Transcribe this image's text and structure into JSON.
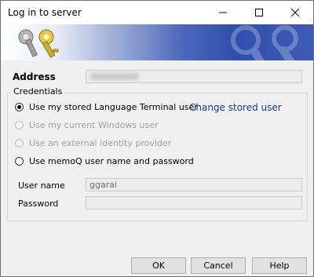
{
  "window": {
    "title": "Log in to server"
  },
  "address": {
    "label": "Address",
    "value": ""
  },
  "credentials": {
    "group_label": "Credentials",
    "options": [
      {
        "label": "Use my stored Language Terminal user",
        "checked": true,
        "enabled": true
      },
      {
        "label": "Use my current Windows user",
        "checked": false,
        "enabled": false
      },
      {
        "label": "Use an external identity provider",
        "checked": false,
        "enabled": false
      },
      {
        "label": "Use memoQ user name and password",
        "checked": false,
        "enabled": true
      }
    ],
    "change_link": "Change stored user"
  },
  "fields": {
    "username_label": "User name",
    "username_value": "ggarai",
    "password_label": "Password",
    "password_value": ""
  },
  "buttons": {
    "ok": "OK",
    "cancel": "Cancel",
    "help": "Help"
  }
}
